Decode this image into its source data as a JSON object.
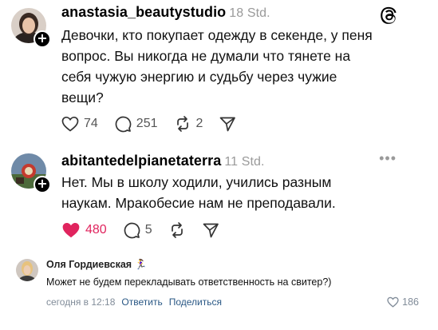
{
  "post1": {
    "username": "anastasia_beautystudio",
    "time": "18 Std.",
    "text": "Девочки, кто покупает одежду в секенде, у пеня вопрос. Вы никогда не думали что тянете на себя чужую энергию и судьбу через чужие вещи?",
    "likes": "74",
    "comments": "251",
    "reposts": "2"
  },
  "post2": {
    "username": "abitantedelpianetaterra",
    "time": "11 Std.",
    "text": "Нет. Мы в школу ходили, учились разным наукам. Мракобесие нам не преподавали.",
    "likes": "480",
    "comments": "5",
    "liked": true
  },
  "vk_comment": {
    "author": "Оля Гордиевская",
    "author_emoji": "🏃‍♀️",
    "text": "Может не будем перекладывать ответственность на свитер?)",
    "time": "сегодня в 12:18",
    "reply_label": "Ответить",
    "share_label": "Поделиться",
    "likes": "186"
  },
  "colors": {
    "like_red": "#e0245e",
    "vk_link": "#2a5885",
    "muted": "#9a9a9a"
  }
}
